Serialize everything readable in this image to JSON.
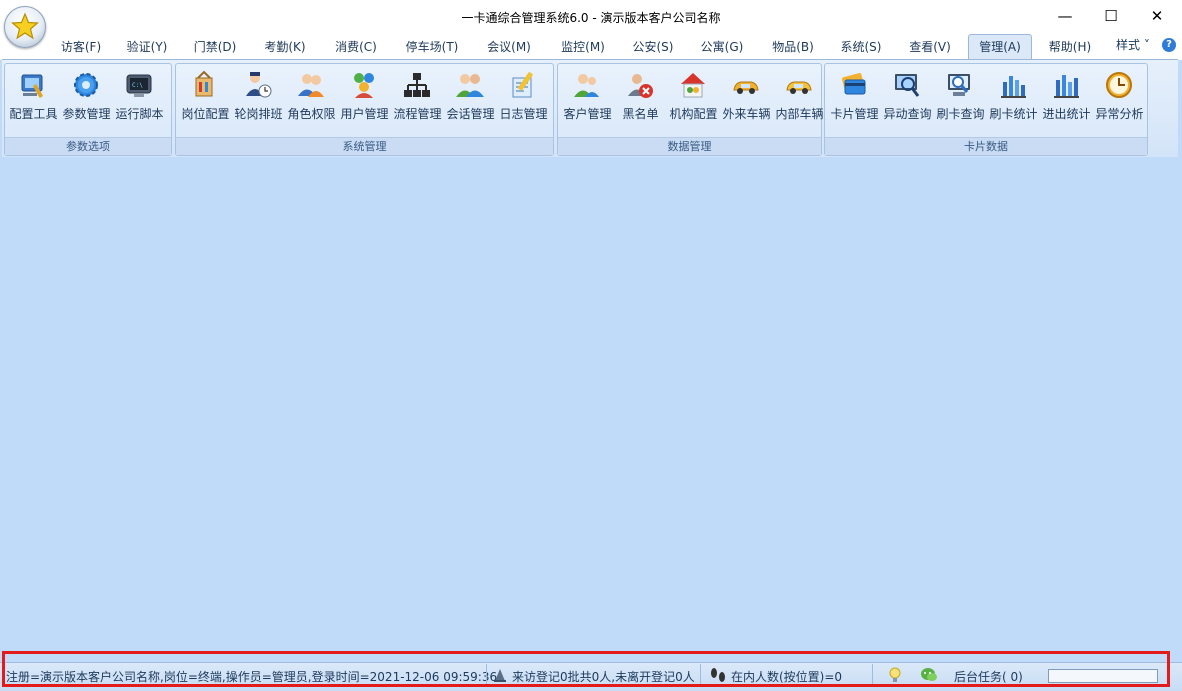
{
  "window": {
    "title": "一卡通综合管理系统6.0 - 演示版本客户公司名称",
    "minimize": "—",
    "maximize": "☐",
    "close": "✕"
  },
  "tabs": [
    {
      "label": "访客(F)"
    },
    {
      "label": "验证(Y)"
    },
    {
      "label": "门禁(D)"
    },
    {
      "label": "考勤(K)"
    },
    {
      "label": "消费(C)"
    },
    {
      "label": "停车场(T)"
    },
    {
      "label": "会议(M)"
    },
    {
      "label": "监控(M)"
    },
    {
      "label": "公安(S)"
    },
    {
      "label": "公寓(G)"
    },
    {
      "label": "物品(B)"
    },
    {
      "label": "系统(S)"
    },
    {
      "label": "查看(V)"
    },
    {
      "label": "管理(A)",
      "active": true
    },
    {
      "label": "帮助(H)"
    }
  ],
  "style_menu": "样式 ˅",
  "help_icon": "?",
  "ribbon": {
    "groups": [
      {
        "label": "参数选项",
        "buttons": [
          {
            "label": "配置工具",
            "icon": "config-tool-icon"
          },
          {
            "label": "参数管理",
            "icon": "gear-icon"
          },
          {
            "label": "运行脚本",
            "icon": "script-icon"
          }
        ]
      },
      {
        "label": "系统管理",
        "buttons": [
          {
            "label": "岗位配置",
            "icon": "post-config-icon"
          },
          {
            "label": "轮岗排班",
            "icon": "shift-schedule-icon"
          },
          {
            "label": "角色权限",
            "icon": "role-permission-icon"
          },
          {
            "label": "用户管理",
            "icon": "user-management-icon"
          },
          {
            "label": "流程管理",
            "icon": "workflow-icon"
          },
          {
            "label": "会话管理",
            "icon": "session-icon"
          },
          {
            "label": "日志管理",
            "icon": "log-icon"
          }
        ]
      },
      {
        "label": "数据管理",
        "buttons": [
          {
            "label": "客户管理",
            "icon": "customer-icon"
          },
          {
            "label": "黑名单",
            "icon": "blacklist-icon"
          },
          {
            "label": "机构配置",
            "icon": "organization-icon"
          },
          {
            "label": "外来车辆",
            "icon": "external-vehicle-icon"
          },
          {
            "label": "内部车辆",
            "icon": "internal-vehicle-icon"
          }
        ]
      },
      {
        "label": "卡片数据",
        "buttons": [
          {
            "label": "卡片管理",
            "icon": "card-icon"
          },
          {
            "label": "异动查询",
            "icon": "change-query-icon"
          },
          {
            "label": "刷卡查询",
            "icon": "swipe-query-icon"
          },
          {
            "label": "刷卡统计",
            "icon": "swipe-stats-icon"
          },
          {
            "label": "进出统计",
            "icon": "entry-exit-stats-icon"
          },
          {
            "label": "异常分析",
            "icon": "clock-icon"
          }
        ]
      }
    ]
  },
  "statusbar": {
    "session_info": "注册=演示版本客户公司名称,岗位=终端,操作员=管理员,登录时间=2021-12-06 09:59:36",
    "visitor_info": "来访登记0批共0人,未离开登记0人",
    "occupancy_info": "在内人数(按位置)=0",
    "background_tasks": "后台任务(    0)",
    "background_progress": 0
  }
}
